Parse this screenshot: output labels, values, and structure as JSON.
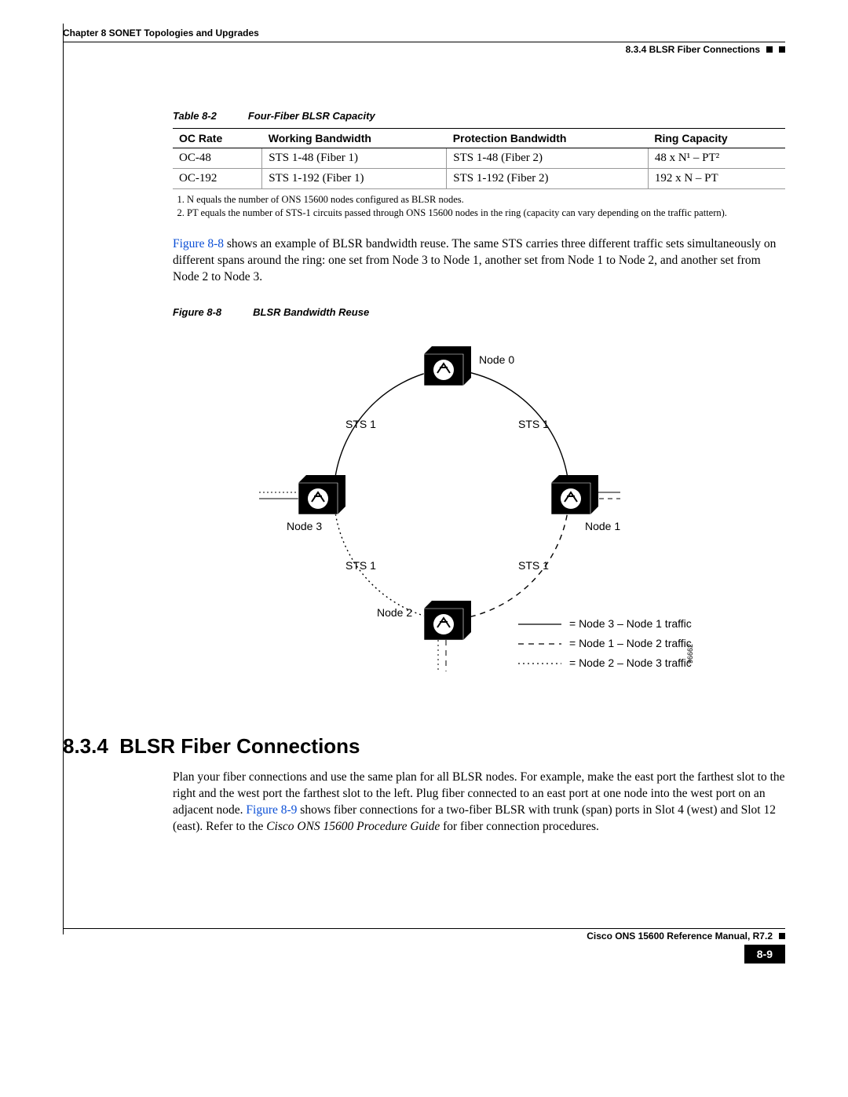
{
  "header": {
    "chapter": "Chapter 8 SONET Topologies and Upgrades",
    "section_ref": "8.3.4  BLSR Fiber Connections"
  },
  "table": {
    "label": "Table 8-2",
    "title": "Four-Fiber BLSR Capacity",
    "headers": [
      "OC Rate",
      "Working Bandwidth",
      "Protection Bandwidth",
      "Ring Capacity"
    ],
    "rows": [
      [
        "OC-48",
        "STS 1-48 (Fiber 1)",
        "STS 1-48 (Fiber 2)",
        "48 x N¹ – PT²"
      ],
      [
        "OC-192",
        "STS 1-192 (Fiber 1)",
        "STS 1-192 (Fiber 2)",
        "192 x N – PT"
      ]
    ],
    "footnotes": [
      "N equals the number of ONS 15600 nodes configured as BLSR nodes.",
      "PT equals the number of STS-1 circuits passed through ONS 15600 nodes in the ring (capacity can vary depending on the traffic pattern)."
    ]
  },
  "paragraph1": {
    "link": "Figure 8-8",
    "rest": " shows an example of BLSR bandwidth reuse. The same STS carries three different traffic sets simultaneously on different spans around the ring: one set from Node 3 to Node 1, another set from Node 1 to Node 2, and another set from Node 2 to Node 3."
  },
  "figure": {
    "label": "Figure 8-8",
    "title": "BLSR Bandwidth Reuse",
    "nodes": {
      "top": "Node 0",
      "right": "Node 1",
      "bottom": "Node 2",
      "left": "Node 3"
    },
    "span_label": "STS 1",
    "legend": {
      "solid": "= Node 3 – Node 1 traffic",
      "dash": "= Node 1 – Node 2 traffic",
      "dot": "= Node 2 – Node 3 traffic"
    },
    "side_id": "96662"
  },
  "section": {
    "number": "8.3.4",
    "title": "BLSR Fiber Connections"
  },
  "paragraph2": {
    "pre": "Plan your fiber connections and use the same plan for all BLSR nodes. For example, make the east port the farthest slot to the right and the west port the farthest slot to the left. Plug fiber connected to an east port at one node into the west port on an adjacent node. ",
    "link": "Figure 8-9",
    "mid": " shows fiber connections for a two-fiber BLSR with trunk (span) ports in Slot 4 (west) and Slot 12 (east). Refer to the ",
    "ital": "Cisco ONS 15600 Procedure Guide",
    "post": " for fiber connection procedures."
  },
  "footer": {
    "manual": "Cisco ONS 15600 Reference Manual, R7.2",
    "page": "8-9"
  }
}
